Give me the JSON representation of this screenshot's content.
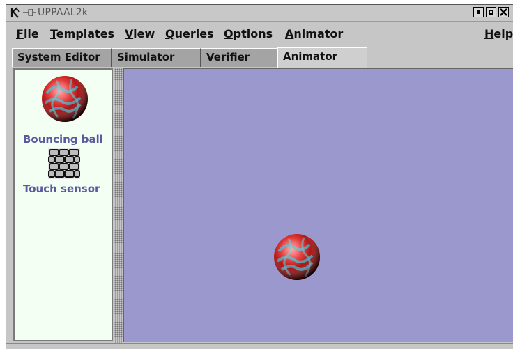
{
  "window": {
    "title": "UPPAAL2k",
    "controls": [
      "minimize-icon",
      "maximize-icon",
      "close-icon"
    ]
  },
  "menubar": {
    "file": {
      "mnemonic": "F",
      "rest": "ile"
    },
    "templates": {
      "mnemonic": "T",
      "rest": "emplates"
    },
    "view": {
      "mnemonic": "V",
      "rest": "iew"
    },
    "queries": {
      "mnemonic": "Q",
      "rest": "ueries"
    },
    "options": {
      "mnemonic": "O",
      "rest": "ptions"
    },
    "animator": {
      "mnemonic": "A",
      "rest": "nimator"
    },
    "help": {
      "mnemonic": "H",
      "rest": "elp"
    }
  },
  "tabs": [
    {
      "label": "System Editor",
      "active": false
    },
    {
      "label": "Simulator",
      "active": false
    },
    {
      "label": "Verifier",
      "active": false
    },
    {
      "label": "Animator",
      "active": true
    }
  ],
  "library": {
    "items": [
      {
        "label": "Bouncing ball",
        "icon": "ball-icon"
      },
      {
        "label": "Touch sensor",
        "icon": "brick-wall-icon"
      }
    ]
  },
  "canvas": {
    "background": "#9a98cc",
    "objects": [
      {
        "icon": "ball-icon"
      }
    ]
  }
}
